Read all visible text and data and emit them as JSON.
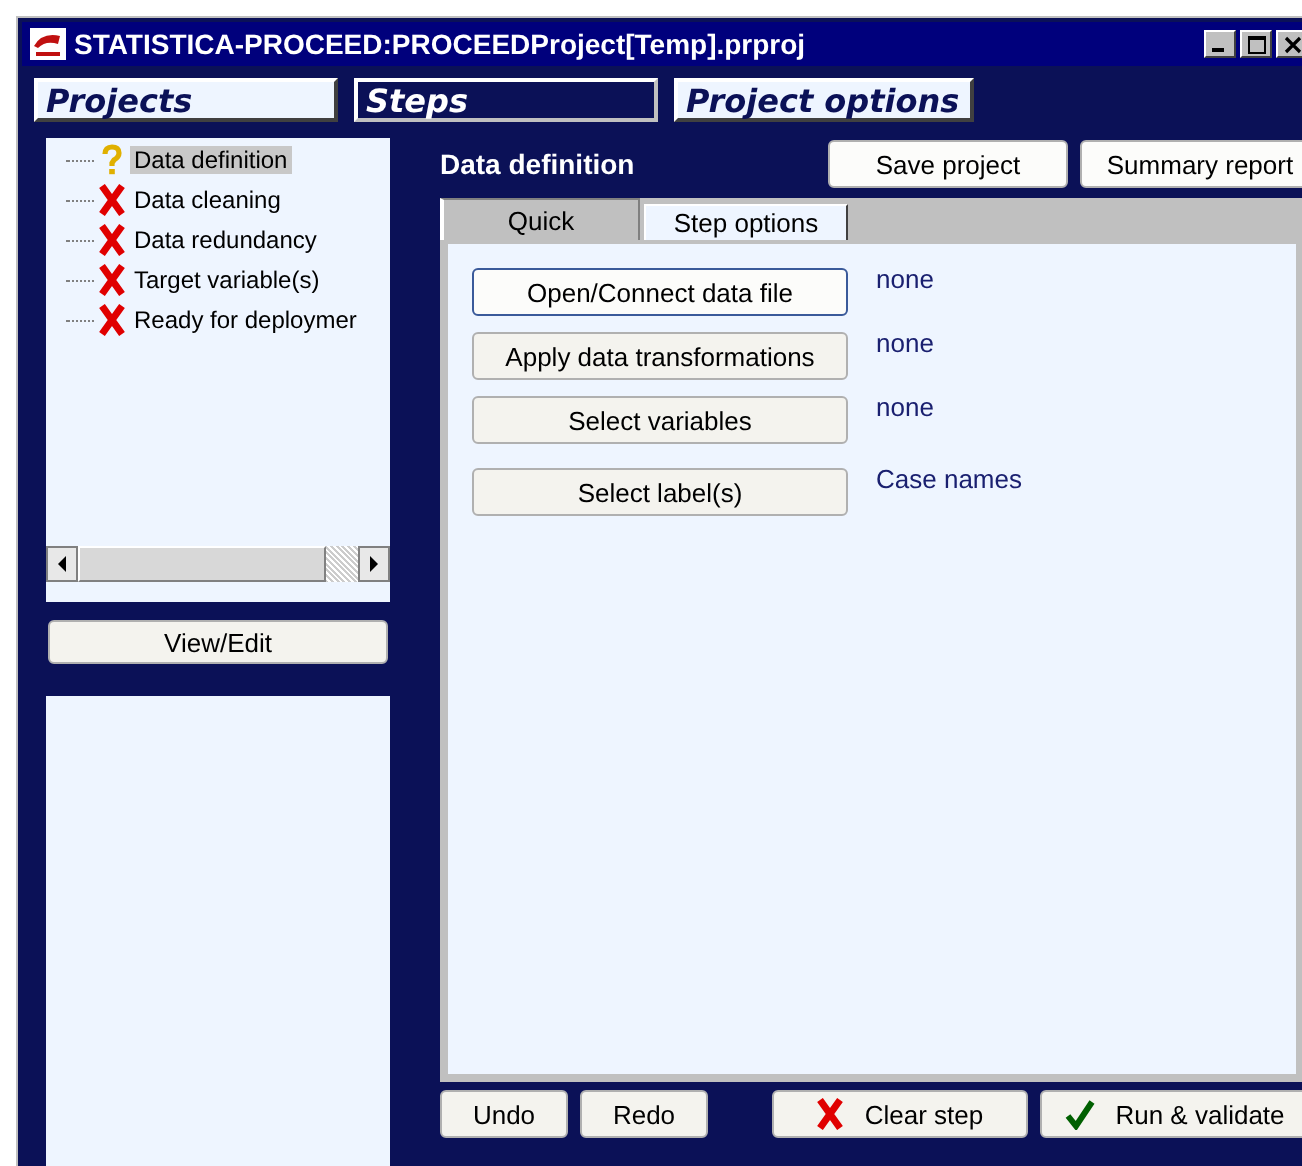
{
  "window": {
    "title": "STATISTICA-PROCEED:PROCEEDProject[Temp].prproj"
  },
  "menu_tabs": [
    {
      "label": "Projects",
      "selected": false
    },
    {
      "label": "Steps",
      "selected": true
    },
    {
      "label": "Project options",
      "selected": false
    }
  ],
  "steps": [
    {
      "label": "Data definition",
      "kind": "pending",
      "selected": true
    },
    {
      "label": "Data cleaning",
      "kind": "failed",
      "selected": false
    },
    {
      "label": "Data redundancy",
      "kind": "failed",
      "selected": false
    },
    {
      "label": "Target variable(s)",
      "kind": "failed",
      "selected": false
    },
    {
      "label": "Ready for deploymer",
      "kind": "failed",
      "selected": false
    }
  ],
  "view_edit_button": "View/Edit",
  "panel": {
    "title": "Data definition",
    "buttons": [
      "Save project",
      "Summary report"
    ]
  },
  "tabs": [
    {
      "label": "Quick",
      "selected": true
    },
    {
      "label": "Step options",
      "selected": false
    }
  ],
  "actions": [
    {
      "label": "Open/Connect data file",
      "value": "none",
      "focused": true
    },
    {
      "label": "Apply data transformations",
      "value": "none",
      "focused": false
    },
    {
      "label": "Select variables",
      "value": "none",
      "focused": false
    },
    {
      "label": "Select label(s)",
      "value": "Case names",
      "focused": false
    }
  ],
  "footer": [
    {
      "label": "Undo",
      "kind": "plain"
    },
    {
      "label": "Redo",
      "kind": "plain"
    },
    {
      "label": "Clear step",
      "kind": "clear"
    },
    {
      "label": "Run & validate",
      "kind": "run"
    }
  ]
}
